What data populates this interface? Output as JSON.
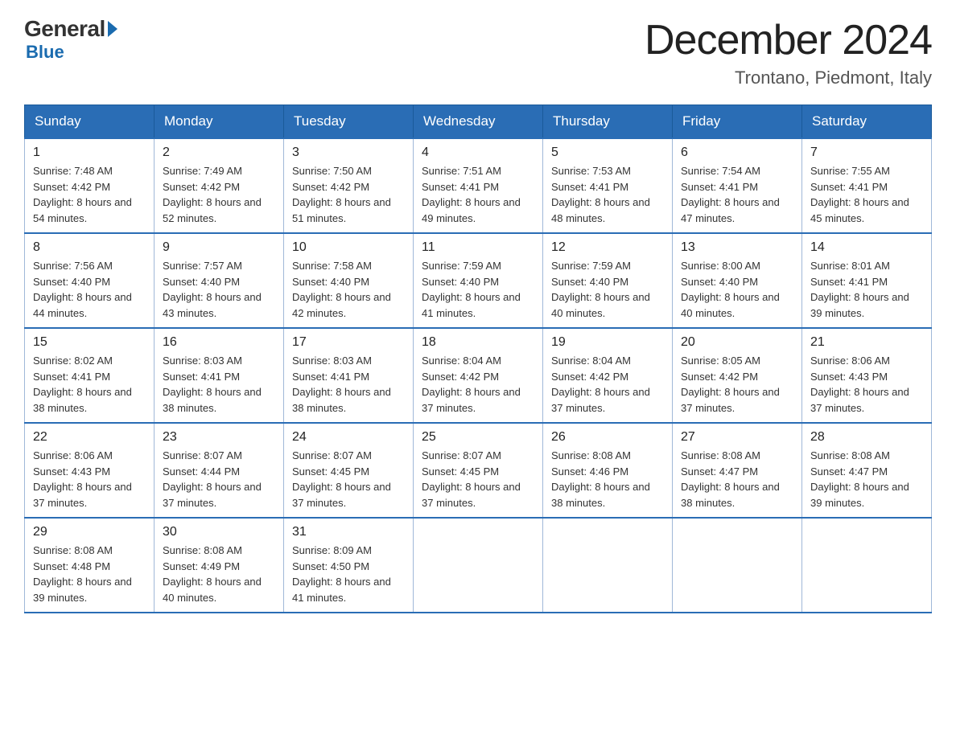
{
  "header": {
    "logo_general": "General",
    "logo_blue": "Blue",
    "month_title": "December 2024",
    "location": "Trontano, Piedmont, Italy"
  },
  "days_of_week": [
    "Sunday",
    "Monday",
    "Tuesday",
    "Wednesday",
    "Thursday",
    "Friday",
    "Saturday"
  ],
  "weeks": [
    [
      {
        "day": "1",
        "sunrise": "7:48 AM",
        "sunset": "4:42 PM",
        "daylight": "8 hours and 54 minutes."
      },
      {
        "day": "2",
        "sunrise": "7:49 AM",
        "sunset": "4:42 PM",
        "daylight": "8 hours and 52 minutes."
      },
      {
        "day": "3",
        "sunrise": "7:50 AM",
        "sunset": "4:42 PM",
        "daylight": "8 hours and 51 minutes."
      },
      {
        "day": "4",
        "sunrise": "7:51 AM",
        "sunset": "4:41 PM",
        "daylight": "8 hours and 49 minutes."
      },
      {
        "day": "5",
        "sunrise": "7:53 AM",
        "sunset": "4:41 PM",
        "daylight": "8 hours and 48 minutes."
      },
      {
        "day": "6",
        "sunrise": "7:54 AM",
        "sunset": "4:41 PM",
        "daylight": "8 hours and 47 minutes."
      },
      {
        "day": "7",
        "sunrise": "7:55 AM",
        "sunset": "4:41 PM",
        "daylight": "8 hours and 45 minutes."
      }
    ],
    [
      {
        "day": "8",
        "sunrise": "7:56 AM",
        "sunset": "4:40 PM",
        "daylight": "8 hours and 44 minutes."
      },
      {
        "day": "9",
        "sunrise": "7:57 AM",
        "sunset": "4:40 PM",
        "daylight": "8 hours and 43 minutes."
      },
      {
        "day": "10",
        "sunrise": "7:58 AM",
        "sunset": "4:40 PM",
        "daylight": "8 hours and 42 minutes."
      },
      {
        "day": "11",
        "sunrise": "7:59 AM",
        "sunset": "4:40 PM",
        "daylight": "8 hours and 41 minutes."
      },
      {
        "day": "12",
        "sunrise": "7:59 AM",
        "sunset": "4:40 PM",
        "daylight": "8 hours and 40 minutes."
      },
      {
        "day": "13",
        "sunrise": "8:00 AM",
        "sunset": "4:40 PM",
        "daylight": "8 hours and 40 minutes."
      },
      {
        "day": "14",
        "sunrise": "8:01 AM",
        "sunset": "4:41 PM",
        "daylight": "8 hours and 39 minutes."
      }
    ],
    [
      {
        "day": "15",
        "sunrise": "8:02 AM",
        "sunset": "4:41 PM",
        "daylight": "8 hours and 38 minutes."
      },
      {
        "day": "16",
        "sunrise": "8:03 AM",
        "sunset": "4:41 PM",
        "daylight": "8 hours and 38 minutes."
      },
      {
        "day": "17",
        "sunrise": "8:03 AM",
        "sunset": "4:41 PM",
        "daylight": "8 hours and 38 minutes."
      },
      {
        "day": "18",
        "sunrise": "8:04 AM",
        "sunset": "4:42 PM",
        "daylight": "8 hours and 37 minutes."
      },
      {
        "day": "19",
        "sunrise": "8:04 AM",
        "sunset": "4:42 PM",
        "daylight": "8 hours and 37 minutes."
      },
      {
        "day": "20",
        "sunrise": "8:05 AM",
        "sunset": "4:42 PM",
        "daylight": "8 hours and 37 minutes."
      },
      {
        "day": "21",
        "sunrise": "8:06 AM",
        "sunset": "4:43 PM",
        "daylight": "8 hours and 37 minutes."
      }
    ],
    [
      {
        "day": "22",
        "sunrise": "8:06 AM",
        "sunset": "4:43 PM",
        "daylight": "8 hours and 37 minutes."
      },
      {
        "day": "23",
        "sunrise": "8:07 AM",
        "sunset": "4:44 PM",
        "daylight": "8 hours and 37 minutes."
      },
      {
        "day": "24",
        "sunrise": "8:07 AM",
        "sunset": "4:45 PM",
        "daylight": "8 hours and 37 minutes."
      },
      {
        "day": "25",
        "sunrise": "8:07 AM",
        "sunset": "4:45 PM",
        "daylight": "8 hours and 37 minutes."
      },
      {
        "day": "26",
        "sunrise": "8:08 AM",
        "sunset": "4:46 PM",
        "daylight": "8 hours and 38 minutes."
      },
      {
        "day": "27",
        "sunrise": "8:08 AM",
        "sunset": "4:47 PM",
        "daylight": "8 hours and 38 minutes."
      },
      {
        "day": "28",
        "sunrise": "8:08 AM",
        "sunset": "4:47 PM",
        "daylight": "8 hours and 39 minutes."
      }
    ],
    [
      {
        "day": "29",
        "sunrise": "8:08 AM",
        "sunset": "4:48 PM",
        "daylight": "8 hours and 39 minutes."
      },
      {
        "day": "30",
        "sunrise": "8:08 AM",
        "sunset": "4:49 PM",
        "daylight": "8 hours and 40 minutes."
      },
      {
        "day": "31",
        "sunrise": "8:09 AM",
        "sunset": "4:50 PM",
        "daylight": "8 hours and 41 minutes."
      },
      null,
      null,
      null,
      null
    ]
  ]
}
